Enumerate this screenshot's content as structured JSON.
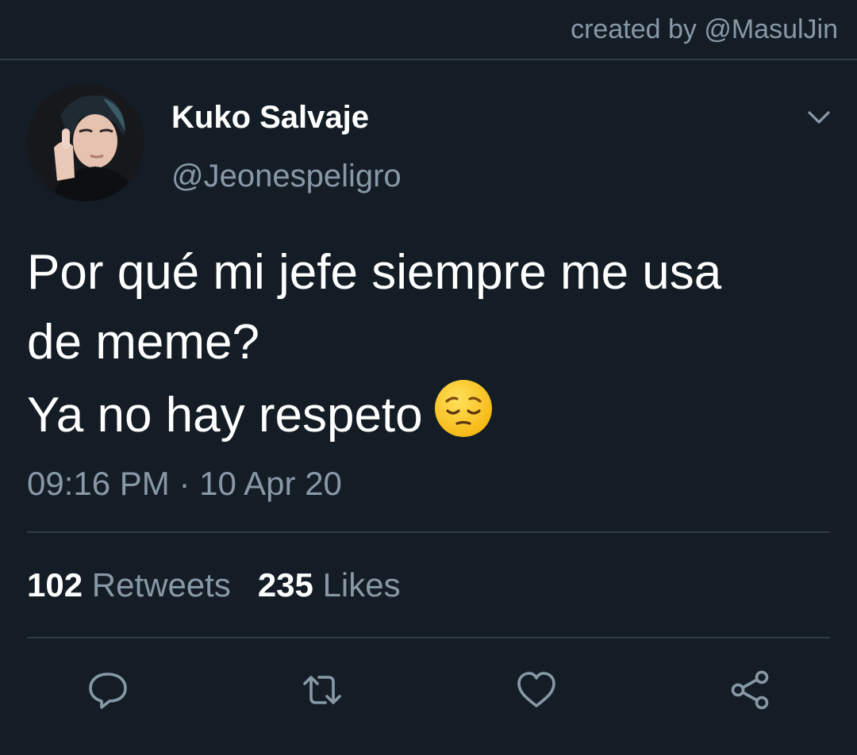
{
  "watermark": "created by @MasulJin",
  "tweet": {
    "display_name": "Kuko Salvaje",
    "handle": "@Jeonespeligro",
    "text_lines": [
      "Por qué mi jefe siempre me usa",
      "de meme?",
      "Ya no hay respeto"
    ],
    "emoji": "pensive-face",
    "timestamp": "09:16 PM · 10 Apr 20",
    "retweets_count": "102",
    "retweets_label": "Retweets",
    "likes_count": "235",
    "likes_label": "Likes"
  },
  "icons": {
    "menu": "chevron-down-icon",
    "reply": "reply-icon",
    "retweet": "retweet-icon",
    "like": "heart-icon",
    "share": "share-icon"
  },
  "colors": {
    "background": "#141d26",
    "primary_text": "#ffffff",
    "secondary_text": "#8899a6",
    "divider": "#2f3b47"
  }
}
